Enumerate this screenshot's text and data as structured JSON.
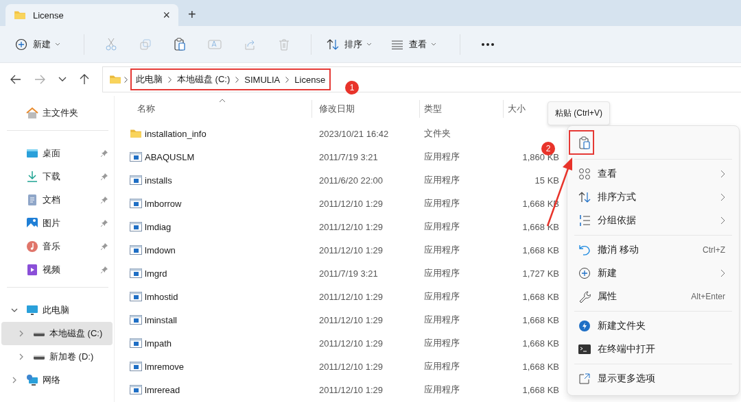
{
  "tab": {
    "title": "License",
    "close": "×",
    "add": "+"
  },
  "toolbar": {
    "new_label": "新建",
    "sort_label": "排序",
    "view_label": "查看"
  },
  "breadcrumb": [
    "此电脑",
    "本地磁盘 (C:)",
    "SIMULIA",
    "License"
  ],
  "sidebar": {
    "home": "主文件夹",
    "quick_access": [
      {
        "label": "桌面",
        "kind": "desktop",
        "pinned": true
      },
      {
        "label": "下载",
        "kind": "download",
        "pinned": true
      },
      {
        "label": "文档",
        "kind": "document",
        "pinned": true
      },
      {
        "label": "图片",
        "kind": "pictures",
        "pinned": true
      },
      {
        "label": "音乐",
        "kind": "music",
        "pinned": true
      },
      {
        "label": "视频",
        "kind": "video",
        "pinned": true
      }
    ],
    "tree": [
      {
        "label": "此电脑",
        "kind": "pc",
        "expanded": true,
        "selected": false,
        "children": [
          {
            "label": "本地磁盘 (C:)",
            "kind": "disk",
            "expanded": false,
            "selected": true
          },
          {
            "label": "新加卷 (D:)",
            "kind": "disk",
            "expanded": false,
            "selected": false
          }
        ]
      },
      {
        "label": "网络",
        "kind": "network",
        "expanded": false,
        "selected": false
      }
    ]
  },
  "table": {
    "columns": [
      "名称",
      "修改日期",
      "类型",
      "大小"
    ],
    "rows": [
      {
        "kind": "folder",
        "name": "installation_info",
        "date": "2023/10/21 16:42",
        "type": "文件夹",
        "size": ""
      },
      {
        "kind": "app",
        "name": "ABAQUSLM",
        "date": "2011/7/19 3:21",
        "type": "应用程序",
        "size": "1,860 KB"
      },
      {
        "kind": "app",
        "name": "installs",
        "date": "2011/6/20 22:00",
        "type": "应用程序",
        "size": "15 KB"
      },
      {
        "kind": "app",
        "name": "lmborrow",
        "date": "2011/12/10 1:29",
        "type": "应用程序",
        "size": "1,668 KB"
      },
      {
        "kind": "app",
        "name": "lmdiag",
        "date": "2011/12/10 1:29",
        "type": "应用程序",
        "size": "1,668 KB"
      },
      {
        "kind": "app",
        "name": "lmdown",
        "date": "2011/12/10 1:29",
        "type": "应用程序",
        "size": "1,668 KB"
      },
      {
        "kind": "app",
        "name": "lmgrd",
        "date": "2011/7/19 3:21",
        "type": "应用程序",
        "size": "1,727 KB"
      },
      {
        "kind": "app",
        "name": "lmhostid",
        "date": "2011/12/10 1:29",
        "type": "应用程序",
        "size": "1,668 KB"
      },
      {
        "kind": "app",
        "name": "lminstall",
        "date": "2011/12/10 1:29",
        "type": "应用程序",
        "size": "1,668 KB"
      },
      {
        "kind": "app",
        "name": "lmpath",
        "date": "2011/12/10 1:29",
        "type": "应用程序",
        "size": "1,668 KB"
      },
      {
        "kind": "app",
        "name": "lmremove",
        "date": "2011/12/10 1:29",
        "type": "应用程序",
        "size": "1,668 KB"
      },
      {
        "kind": "app",
        "name": "lmreread",
        "date": "2011/12/10 1:29",
        "type": "应用程序",
        "size": "1,668 KB"
      }
    ]
  },
  "tooltip": "粘贴 (Ctrl+V)",
  "context_menu": {
    "sections": [
      [
        {
          "kind": "view",
          "label": "查看",
          "submenu": true
        },
        {
          "kind": "sort",
          "label": "排序方式",
          "submenu": true
        },
        {
          "kind": "group",
          "label": "分组依据",
          "submenu": true
        }
      ],
      [
        {
          "kind": "undo",
          "label": "撤消 移动",
          "shortcut": "Ctrl+Z",
          "submenu": false
        },
        {
          "kind": "new",
          "label": "新建",
          "submenu": true
        },
        {
          "kind": "properties",
          "label": "属性",
          "shortcut": "Alt+Enter",
          "submenu": false
        }
      ],
      [
        {
          "kind": "newfolder",
          "label": "新建文件夹",
          "submenu": false
        },
        {
          "kind": "terminal",
          "label": "在终端中打开",
          "submenu": false
        }
      ],
      [
        {
          "kind": "more",
          "label": "显示更多选项",
          "submenu": false
        }
      ]
    ]
  },
  "annotations": [
    "1",
    "2"
  ]
}
